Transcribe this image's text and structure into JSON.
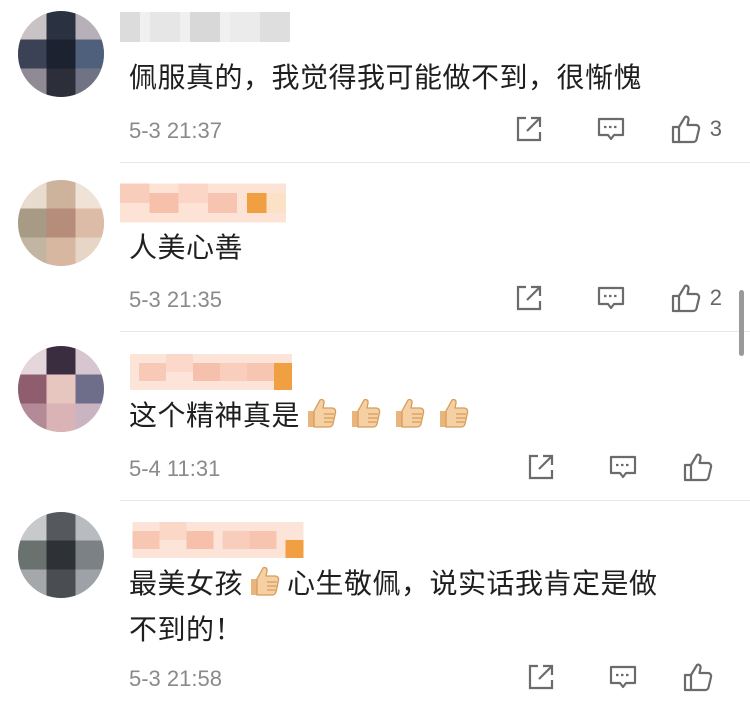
{
  "comments": [
    {
      "text": "佩服真的，我觉得我可能做不到，很惭愧",
      "time": "5-3 21:37",
      "like_count": "3"
    },
    {
      "text": "人美心善",
      "time": "5-3 21:35",
      "like_count": "2"
    },
    {
      "text_before": "这个精神真是",
      "thumbs_count": 4,
      "time": "5-4 11:31",
      "like_count": ""
    },
    {
      "text_part1": "最美女孩",
      "text_part2": "心生敬佩，说实话我肯定是做",
      "text_line2": "不到的！",
      "time": "5-3 21:58",
      "like_count": ""
    }
  ],
  "icons": {
    "share": "share-icon",
    "reply": "comment-icon",
    "like": "thumbs-up-icon",
    "emoji": "thumbs-up-emoji"
  },
  "colors": {
    "text": "#1f1f1f",
    "meta": "#8a8a8a",
    "icon": "#666666",
    "divider": "#e6e6e6",
    "emoji_skin": "#f3cfa0",
    "name_mosaic": "#f6c6a6",
    "name_accent": "#f0a040"
  }
}
